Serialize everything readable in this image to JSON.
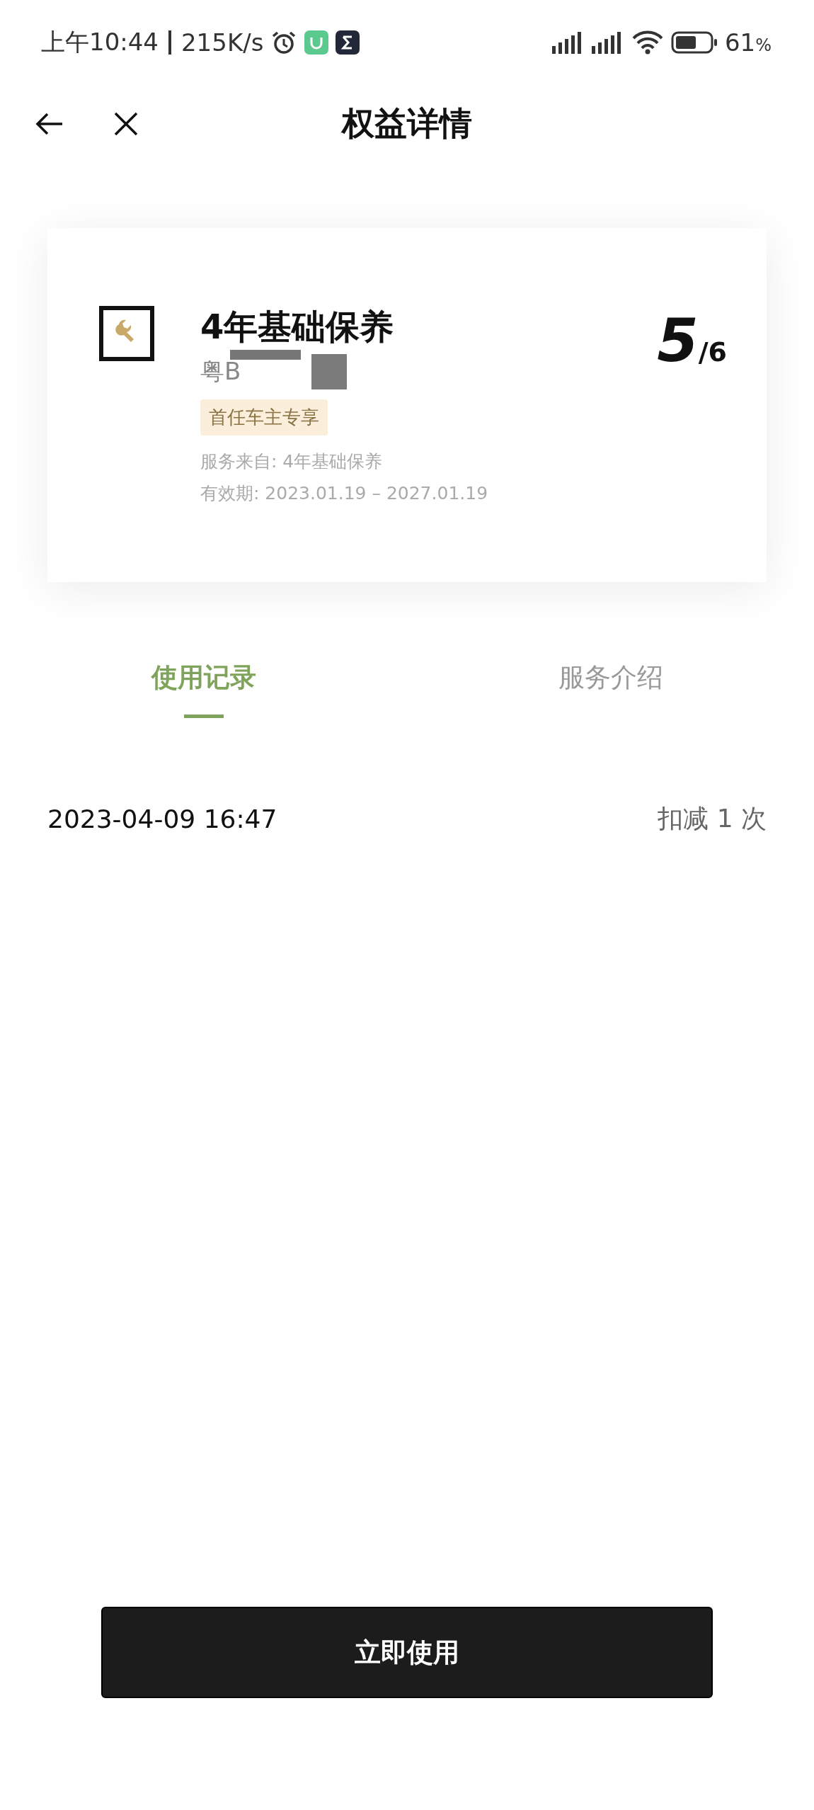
{
  "status_bar": {
    "time": "上午10:44",
    "speed": "215K/s",
    "battery_percent": "61",
    "battery_unit": "%"
  },
  "nav": {
    "title": "权益详情"
  },
  "card": {
    "title": "4年基础保养",
    "plate": "粤B",
    "tag": "首任车主专享",
    "source": "服务来自: 4年基础保养",
    "validity": "有效期: 2023.01.19 – 2027.01.19",
    "remaining": "5",
    "total": "/6"
  },
  "tabs": [
    {
      "label": "使用记录",
      "selected": true
    },
    {
      "label": "服务介绍",
      "selected": false
    }
  ],
  "records": [
    {
      "time": "2023-04-09 16:47",
      "action": "扣减 1 次"
    }
  ],
  "primary_button": "立即使用"
}
